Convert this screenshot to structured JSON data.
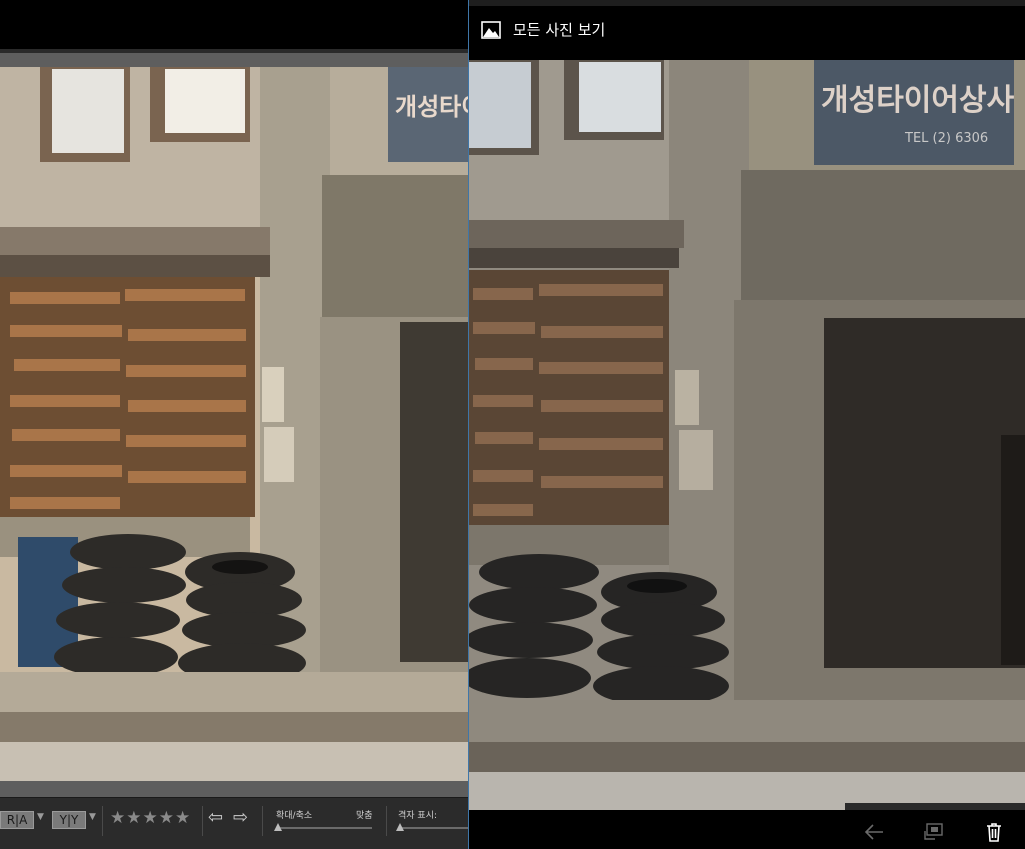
{
  "editor": {
    "toolbar": {
      "view_mode_1": "R|A",
      "view_mode_2": "Y|Y",
      "rating_stars": "★★★★★",
      "prev_arrow": "🡐",
      "next_arrow": "🡒",
      "zoom_label": "확대/축소",
      "fit_label": "맞춤",
      "grid_label": "격자 표시:"
    }
  },
  "viewer": {
    "title": "모든 사진 보기",
    "icons": {
      "app": "photo-icon",
      "back": "back-arrow-icon",
      "share": "slideshow-icon",
      "delete": "trash-icon"
    }
  },
  "photo": {
    "sign_text": "개성타이어상사",
    "sign_sub": "TEL (2) 6306"
  },
  "colors": {
    "accent_divider": "#3f76a8",
    "toolbar_bg": "#2b2b2b",
    "frame_bg": "#5e5e5e"
  }
}
